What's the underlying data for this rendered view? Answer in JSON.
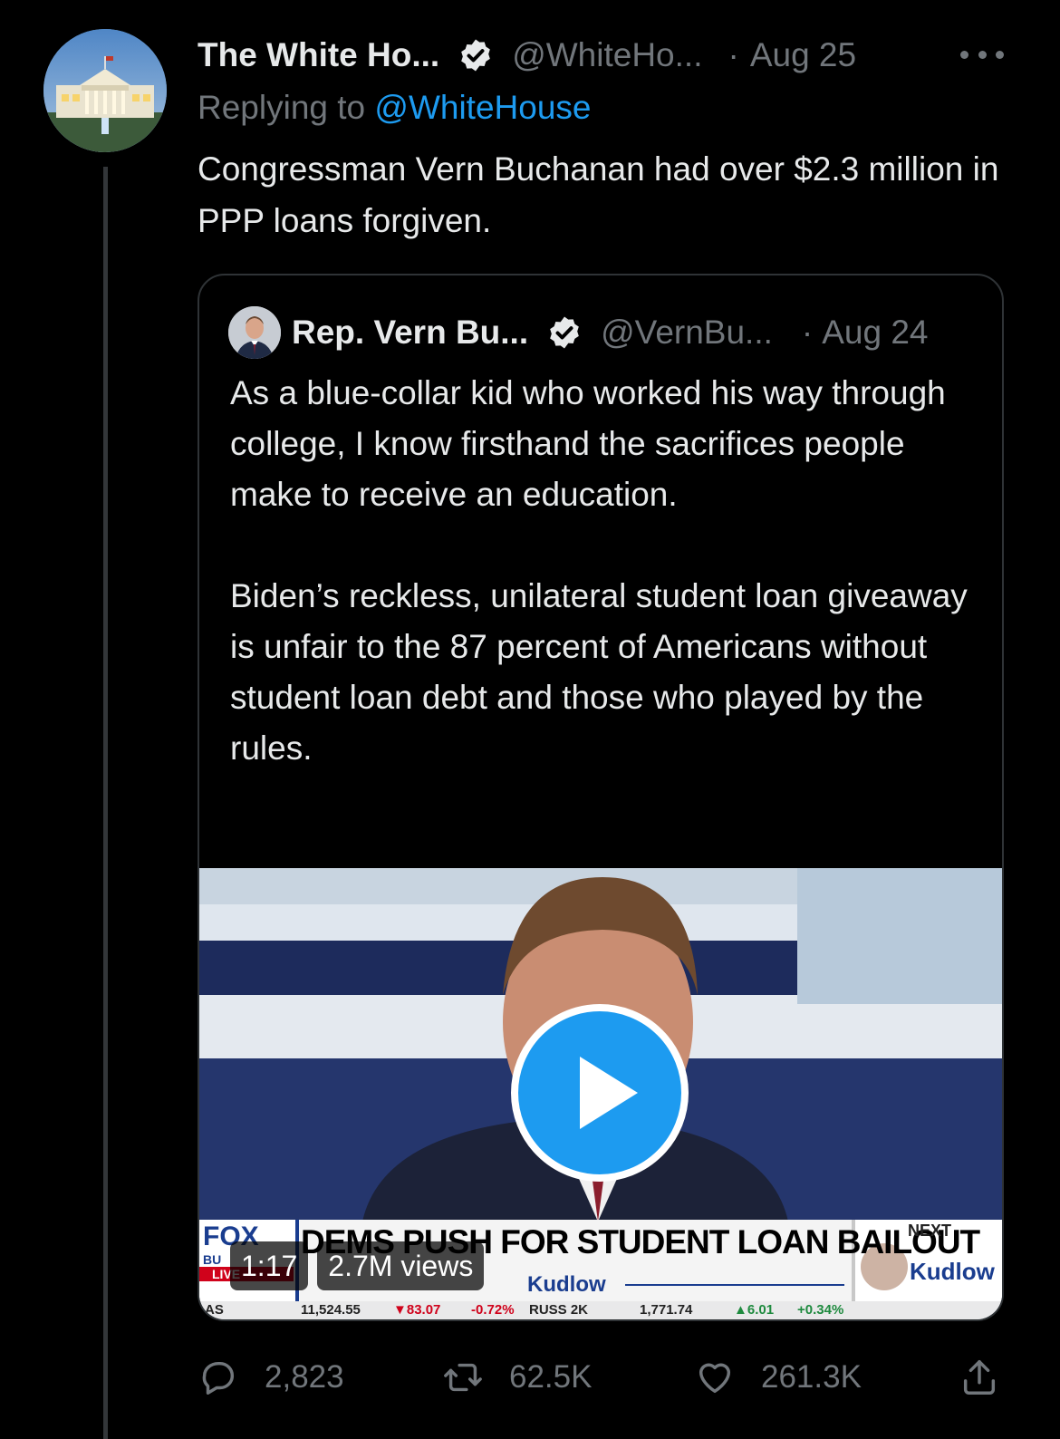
{
  "tweet": {
    "author_name": "The White Ho...",
    "handle": "@WhiteHo...",
    "separator": "·",
    "date": "Aug 25",
    "replying_prefix": "Replying to",
    "replying_mention": "@WhiteHouse",
    "text": "Congressman Vern Buchanan had over $2.3 million in PPP loans forgiven."
  },
  "quoted_tweet": {
    "author_name": "Rep. Vern Bu...",
    "handle": "@VernBu...",
    "separator": "·",
    "date": "Aug 24",
    "paragraphs": [
      "As a blue-collar kid who worked his way through college, I know firsthand the sacrifices people make to receive an education.",
      "Biden’s reckless, unilateral student loan giveaway is unfair to the 87 percent of Americans without student loan debt and those who played by the rules."
    ],
    "video": {
      "duration": "1:17",
      "views": "2.7M views",
      "chyron": "DEMS PUSH FOR STUDENT LOAN BAILOUT",
      "show_name": "Kudlow",
      "network_top": "FOX",
      "network_sub": "BU",
      "live_tag": "LIVE",
      "next_label": "NEXT",
      "next_show": "Kudlow",
      "ticker": [
        "AS",
        "11,524.55",
        "▼83.07",
        "-0.72%",
        "RUSS 2K",
        "1,771.74",
        "▲6.01",
        "+0.34%"
      ]
    }
  },
  "actions": {
    "reply_count": "2,823",
    "retweet_count": "62.5K",
    "like_count": "261.3K"
  },
  "colors": {
    "background": "#000000",
    "text_primary": "#e7e9ea",
    "text_secondary": "#71767b",
    "accent": "#1d9bf0",
    "border": "#2f3336"
  },
  "icons": [
    "more-icon",
    "verified-badge-icon",
    "reply-icon",
    "retweet-icon",
    "like-icon",
    "share-icon",
    "play-icon"
  ]
}
